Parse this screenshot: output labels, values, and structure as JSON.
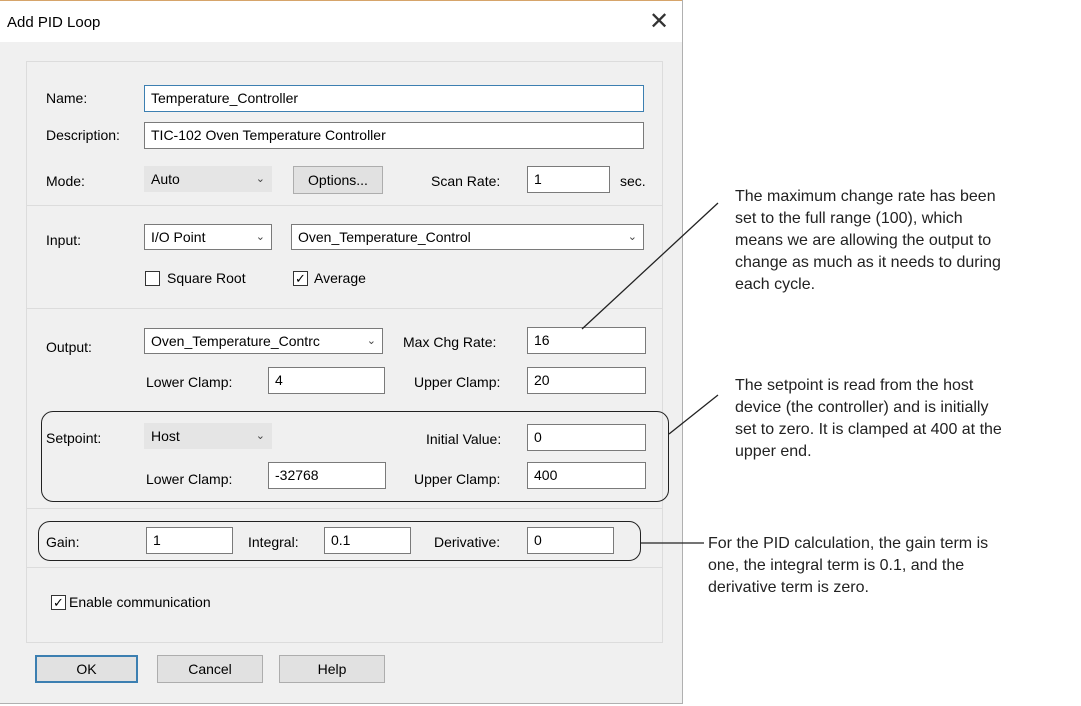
{
  "dialog": {
    "title": "Add PID Loop",
    "close_glyph": "✕"
  },
  "general": {
    "name_label": "Name:",
    "name_value": "Temperature_Controller",
    "description_label": "Description:",
    "description_value": "TIC-102 Oven Temperature Controller",
    "mode_label": "Mode:",
    "mode_value": "Auto",
    "options_button": "Options...",
    "scan_rate_label": "Scan Rate:",
    "scan_rate_value": "1",
    "scan_rate_unit": "sec."
  },
  "input": {
    "label": "Input:",
    "type_value": "I/O Point",
    "point_value": "Oven_Temperature_Control",
    "square_root_label": "Square Root",
    "square_root_checked": false,
    "average_label": "Average",
    "average_checked": true
  },
  "output": {
    "label": "Output:",
    "point_value": "Oven_Temperature_Contrc",
    "max_chg_rate_label": "Max Chg Rate:",
    "max_chg_rate_value": "16",
    "lower_clamp_label": "Lower Clamp:",
    "lower_clamp_value": "4",
    "upper_clamp_label": "Upper Clamp:",
    "upper_clamp_value": "20"
  },
  "setpoint": {
    "label": "Setpoint:",
    "source_value": "Host",
    "initial_value_label": "Initial Value:",
    "initial_value": "0",
    "lower_clamp_label": "Lower Clamp:",
    "lower_clamp_value": "-32768",
    "upper_clamp_label": "Upper Clamp:",
    "upper_clamp_value": "400"
  },
  "tuning": {
    "gain_label": "Gain:",
    "gain_value": "1",
    "integral_label": "Integral:",
    "integral_value": "0.1",
    "derivative_label": "Derivative:",
    "derivative_value": "0"
  },
  "enable_communication": {
    "label": "Enable communication",
    "checked": true
  },
  "buttons": {
    "ok": "OK",
    "cancel": "Cancel",
    "help": "Help"
  },
  "annotations": {
    "max_chg_rate": [
      "The maximum change rate has been",
      "set to the full range (100), which",
      "means we are allowing the output to",
      "change as much as it needs to during",
      "each cycle."
    ],
    "setpoint": [
      "The setpoint is read from the host",
      "device (the controller) and is initially",
      "set to zero. It is clamped at 400 at the",
      "upper end."
    ],
    "pid": [
      "For the PID calculation, the gain term is",
      "one, the integral term is 0.1, and the",
      "derivative term is zero."
    ]
  },
  "icons": {
    "dropdown": "chevron-down-icon",
    "check": "checkmark-icon",
    "close": "close-icon"
  }
}
